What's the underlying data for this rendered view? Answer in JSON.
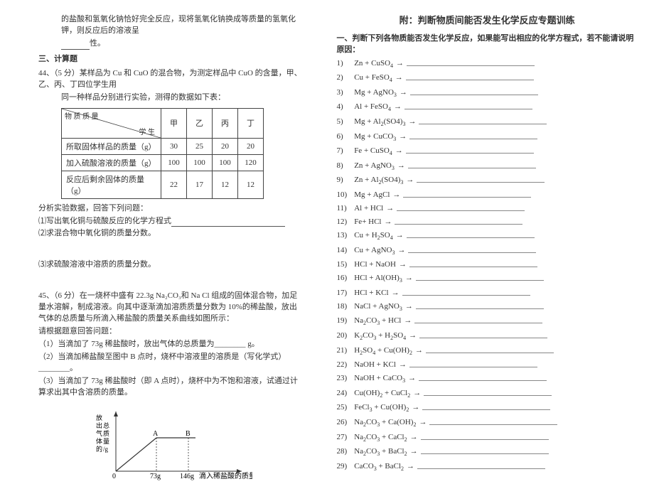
{
  "left": {
    "tail_line": "的盐酸和氢氧化钠恰好完全反应，现将氢氧化钠换成等质量的氢氧化钾，则反应后的溶液呈",
    "tail_line2": "性。",
    "section3": "三、计算题",
    "q44_head": "44、（5 分）某样品为 Cu 和 CuO 的混合物，为测定样品中 CuO 的含量，甲、乙、丙、丁四位学生用",
    "q44_head2": "同一种样品分别进行实验，测得的数据如下表：",
    "table": {
      "diag_tl": "物   质   质   量",
      "diag_br": "学   生",
      "cols": [
        "甲",
        "乙",
        "丙",
        "丁"
      ],
      "rows": [
        {
          "label": "所取固体样品的质量（g）",
          "vals": [
            "30",
            "25",
            "20",
            "20"
          ]
        },
        {
          "label": "加入硫酸溶液的质量（g）",
          "vals": [
            "100",
            "100",
            "100",
            "120"
          ]
        },
        {
          "label": "反应后剩余固体的质量（g）",
          "vals": [
            "22",
            "17",
            "12",
            "12"
          ]
        }
      ]
    },
    "q44_after": "分析实验数据，回答下列问题：",
    "q44_1": "⑴写出氧化铜与硫酸反应的化学方程式",
    "q44_2": "⑵求混合物中氧化铜的质量分数。",
    "q44_3": "⑶求硫酸溶液中溶质的质量分数。",
    "q45_head": "45、（6 分）在一烧杯中盛有 22.3g Na₂CO₃和 Na Cl 组成的固体混合物，加足量水溶解，制成溶液。向其中逐渐滴加溶质质量分数为 10%的稀盐酸，放出气体的总质量与所滴入稀盐酸的质量关系曲线如图所示：",
    "q45_prompt": "请根据题意回答问题：",
    "q45_1": "（1）当滴加了 73g 稀盐酸时，放出气体的总质量为________ g。",
    "q45_2": "（2）当滴加稀盐酸至图中 B 点时，烧杯中溶液里的溶质是（写化学式）________。",
    "q45_3": "（3）当滴加了 73g 稀盐酸时（即 A 点时），烧杯中为不饱和溶液，试通过计算求出其中含溶质的质量。",
    "chart": {
      "ylabel": "放出气体的总质量/g",
      "xlabel": "滴入稀盐酸的质量/g",
      "xticks": [
        "0",
        "73g",
        "146g"
      ],
      "points": [
        "A",
        "B"
      ]
    }
  },
  "right": {
    "title": "附：判断物质间能否发生化学反应专题训练",
    "instr": "一、判断下列各物质能否发生化学反应，如果能写出相应的化学方程式，若不能请说明原因：",
    "items": [
      "Zn  +  CuSO₄",
      "Cu  +  FeSO₄",
      "Mg  +  AgNO₃",
      "Al  +  FeSO₄",
      "Mg  +  Al₂(SO4)₃",
      "Mg  +  CuCO₃",
      "Fe  +  CuSO₄",
      "Zn +  AgNO₃",
      "Zn +  Al₂(SO4)₃",
      "Mg  +  AgCl",
      "Al  +  HCl",
      "Fe+  HCl",
      "Cu  +  H₂SO₄",
      "Cu  +  AgNO₃",
      "HCl  +  NaOH",
      "HCl  +  Al(OH)₃",
      "HCl  +  KCl",
      "NaCl  +  AgNO₃",
      "Na₂CO₃  +  HCl",
      "K₂CO₃  +  H₂SO₄",
      "H₂SO₄  +  Cu(OH)₂",
      "NaOH  +  KCl",
      "NaOH  +  CaCO₃",
      "Cu(OH)₂  +  CuCl₂",
      "FeCl₃  +  Cu(OH)₂",
      "Na₂CO₃  +  Ca(OH)₂",
      "Na₂CO₃  +  CaCl₂",
      "Na₂CO₃  +  BaCl₂",
      "CaCO₃  +  BaCl₂"
    ]
  }
}
